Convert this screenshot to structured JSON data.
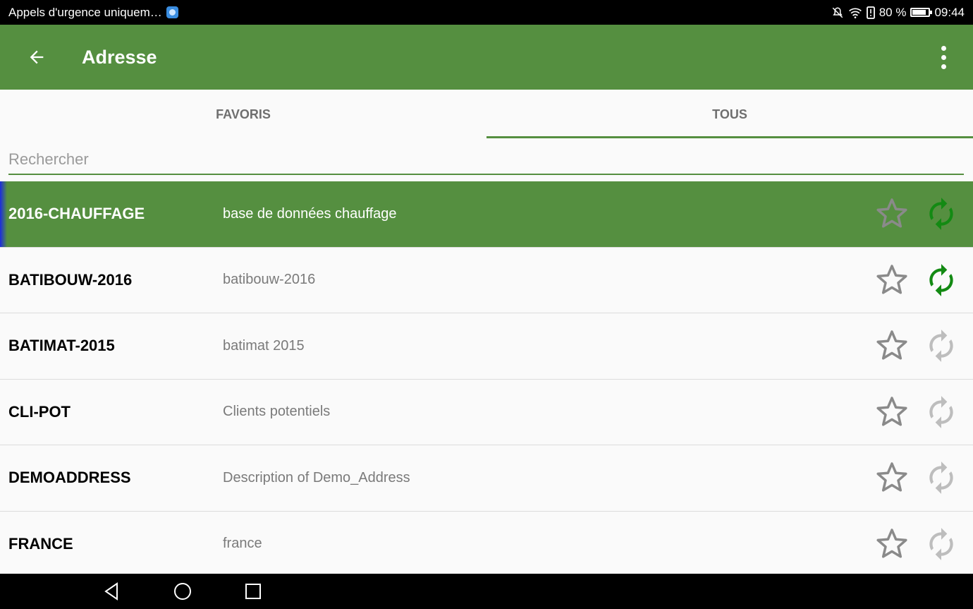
{
  "statusbar": {
    "notification_text": "Appels d'urgence uniquem…",
    "battery_percent": "80 %",
    "time": "09:44",
    "icons": [
      "mute-icon",
      "wifi-icon",
      "alert-icon",
      "battery-icon"
    ]
  },
  "appbar": {
    "title": "Adresse",
    "back_icon": "arrow-back-icon",
    "menu_icon": "more-vert-icon"
  },
  "tabs": [
    {
      "label": "FAVORIS",
      "active": false
    },
    {
      "label": "TOUS",
      "active": true
    }
  ],
  "search": {
    "placeholder": "Rechercher",
    "value": ""
  },
  "rows": [
    {
      "name": "2016-CHAUFFAGE",
      "description": "base de données chauffage",
      "selected": true,
      "favorite": false,
      "sync_active": true
    },
    {
      "name": "BATIBOUW-2016",
      "description": "batibouw-2016",
      "selected": false,
      "favorite": false,
      "sync_active": true
    },
    {
      "name": "BATIMAT-2015",
      "description": "batimat 2015",
      "selected": false,
      "favorite": false,
      "sync_active": false
    },
    {
      "name": "CLI-POT",
      "description": "Clients potentiels",
      "selected": false,
      "favorite": false,
      "sync_active": false
    },
    {
      "name": "DEMOADDRESS",
      "description": "Description  of Demo_Address",
      "selected": false,
      "favorite": false,
      "sync_active": false
    },
    {
      "name": "FRANCE",
      "description": "france",
      "selected": false,
      "favorite": false,
      "sync_active": false
    }
  ],
  "colors": {
    "primary": "#558f40",
    "sync_active": "#138a13",
    "sync_inactive": "#bdbdbd",
    "star": "#8a8a8a"
  },
  "navbar": {
    "icons": [
      "back-triangle-icon",
      "home-circle-icon",
      "recents-square-icon"
    ]
  }
}
